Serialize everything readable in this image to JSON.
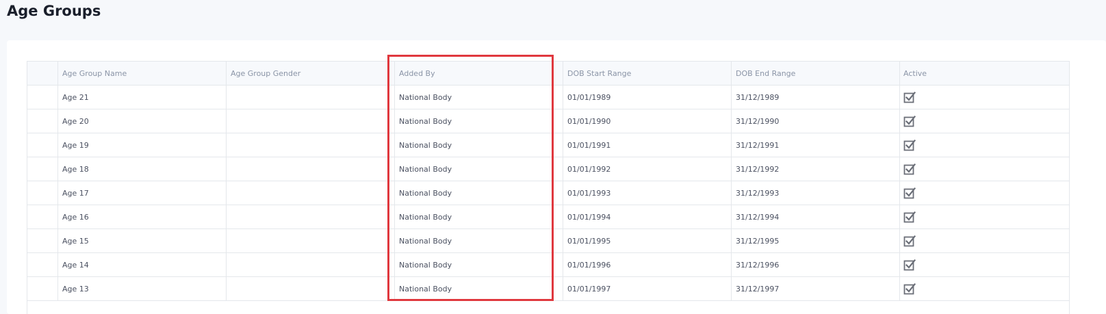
{
  "page": {
    "title": "Age Groups"
  },
  "table": {
    "headers": [
      "",
      "Age Group Name",
      "Age Group Gender",
      "Added By",
      "DOB Start Range",
      "DOB End Range",
      "Active"
    ],
    "rows": [
      {
        "name": "Age 21",
        "gender": "",
        "added_by": "National Body",
        "dob_start": "01/01/1989",
        "dob_end": "31/12/1989",
        "active": true
      },
      {
        "name": "Age 20",
        "gender": "",
        "added_by": "National Body",
        "dob_start": "01/01/1990",
        "dob_end": "31/12/1990",
        "active": true
      },
      {
        "name": "Age 19",
        "gender": "",
        "added_by": "National Body",
        "dob_start": "01/01/1991",
        "dob_end": "31/12/1991",
        "active": true
      },
      {
        "name": "Age 18",
        "gender": "",
        "added_by": "National Body",
        "dob_start": "01/01/1992",
        "dob_end": "31/12/1992",
        "active": true
      },
      {
        "name": "Age 17",
        "gender": "",
        "added_by": "National Body",
        "dob_start": "01/01/1993",
        "dob_end": "31/12/1993",
        "active": true
      },
      {
        "name": "Age 16",
        "gender": "",
        "added_by": "National Body",
        "dob_start": "01/01/1994",
        "dob_end": "31/12/1994",
        "active": true
      },
      {
        "name": "Age 15",
        "gender": "",
        "added_by": "National Body",
        "dob_start": "01/01/1995",
        "dob_end": "31/12/1995",
        "active": true
      },
      {
        "name": "Age 14",
        "gender": "",
        "added_by": "National Body",
        "dob_start": "01/01/1996",
        "dob_end": "31/12/1996",
        "active": true
      },
      {
        "name": "Age 13",
        "gender": "",
        "added_by": "National Body",
        "dob_start": "01/01/1997",
        "dob_end": "31/12/1997",
        "active": true
      }
    ],
    "active_icon": "checkbox-checked-icon"
  },
  "colors": {
    "highlight": "#e0383e",
    "icon": "#6b6f78"
  }
}
